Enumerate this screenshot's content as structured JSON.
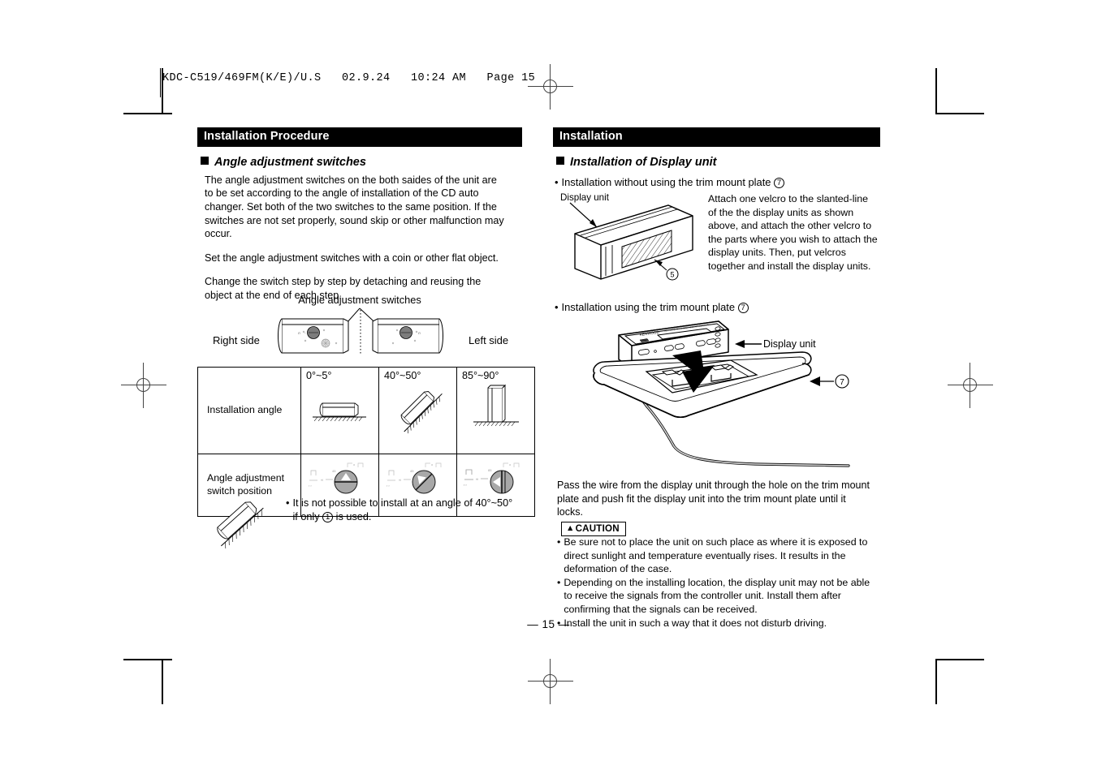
{
  "slug": "KDC-C519/469FM(K/E)/U.S   02.9.24   10:24 AM   Page 15",
  "left_column": {
    "section_title": "Installation Procedure",
    "sub_heading": "Angle adjustment switches",
    "paragraphs": [
      "The angle adjustment switches on the both saides of the unit are to be set according to the angle of installation of the CD auto changer. Set both of the two switches to the same position. If the switches are not set properly, sound skip or other malfunction may occur.",
      "Set the angle adjustment switches with a coin or other flat object.",
      "Change the switch step by step by detaching and reusing the object at the end of each step."
    ],
    "figure": {
      "caption": "Angle adjustment switches",
      "right_label": "Right side",
      "left_label": "Left side"
    },
    "table": {
      "row_labels": [
        "Installation angle",
        "Angle adjustment switch position"
      ],
      "columns": [
        "0°~5°",
        "40°~50°",
        "85°~90°"
      ]
    },
    "note": {
      "bullet": "•",
      "text_before": "It is not possible to install at an angle of 40°~50° if only",
      "circled": "1",
      "text_after": "is used."
    }
  },
  "right_column": {
    "section_title": "Installation",
    "sub_heading": "Installation of Display unit",
    "item1": {
      "bullet": "•",
      "text": "Installation without using the trim mount plate",
      "circled": "7"
    },
    "display_unit_label": "Display unit",
    "velcro_callout": "5",
    "velcro_text": "Attach one velcro to the slanted-line of the the display units as shown above, and attach the other velcro to the parts where you wish to attach the display units. Then, put velcros together and install the display units.",
    "item2": {
      "bullet": "•",
      "text": "Installation using the trim mount plate",
      "circled": "7"
    },
    "trim_figure": {
      "display_unit_label": "Display unit",
      "plate_callout": "7",
      "brand": "KENWOOD"
    },
    "pass_text": "Pass the wire from the display unit through the hole on the trim mount plate and push fit the display unit into the trim mount plate until it locks.",
    "caution_label": "CAUTION",
    "caution_triangle": "▲",
    "caution_items": [
      "Be sure not to place the unit on such place as where it is exposed to direct sunlight and temperature eventually rises. It results in the deformation of the case.",
      "Depending on the installing location, the display unit may not be able to receive the signals from the controller unit. Install them after confirming that the signals can be received.",
      "Install the unit in such a way that it does not disturb driving."
    ]
  },
  "page_number": "— 15 —"
}
